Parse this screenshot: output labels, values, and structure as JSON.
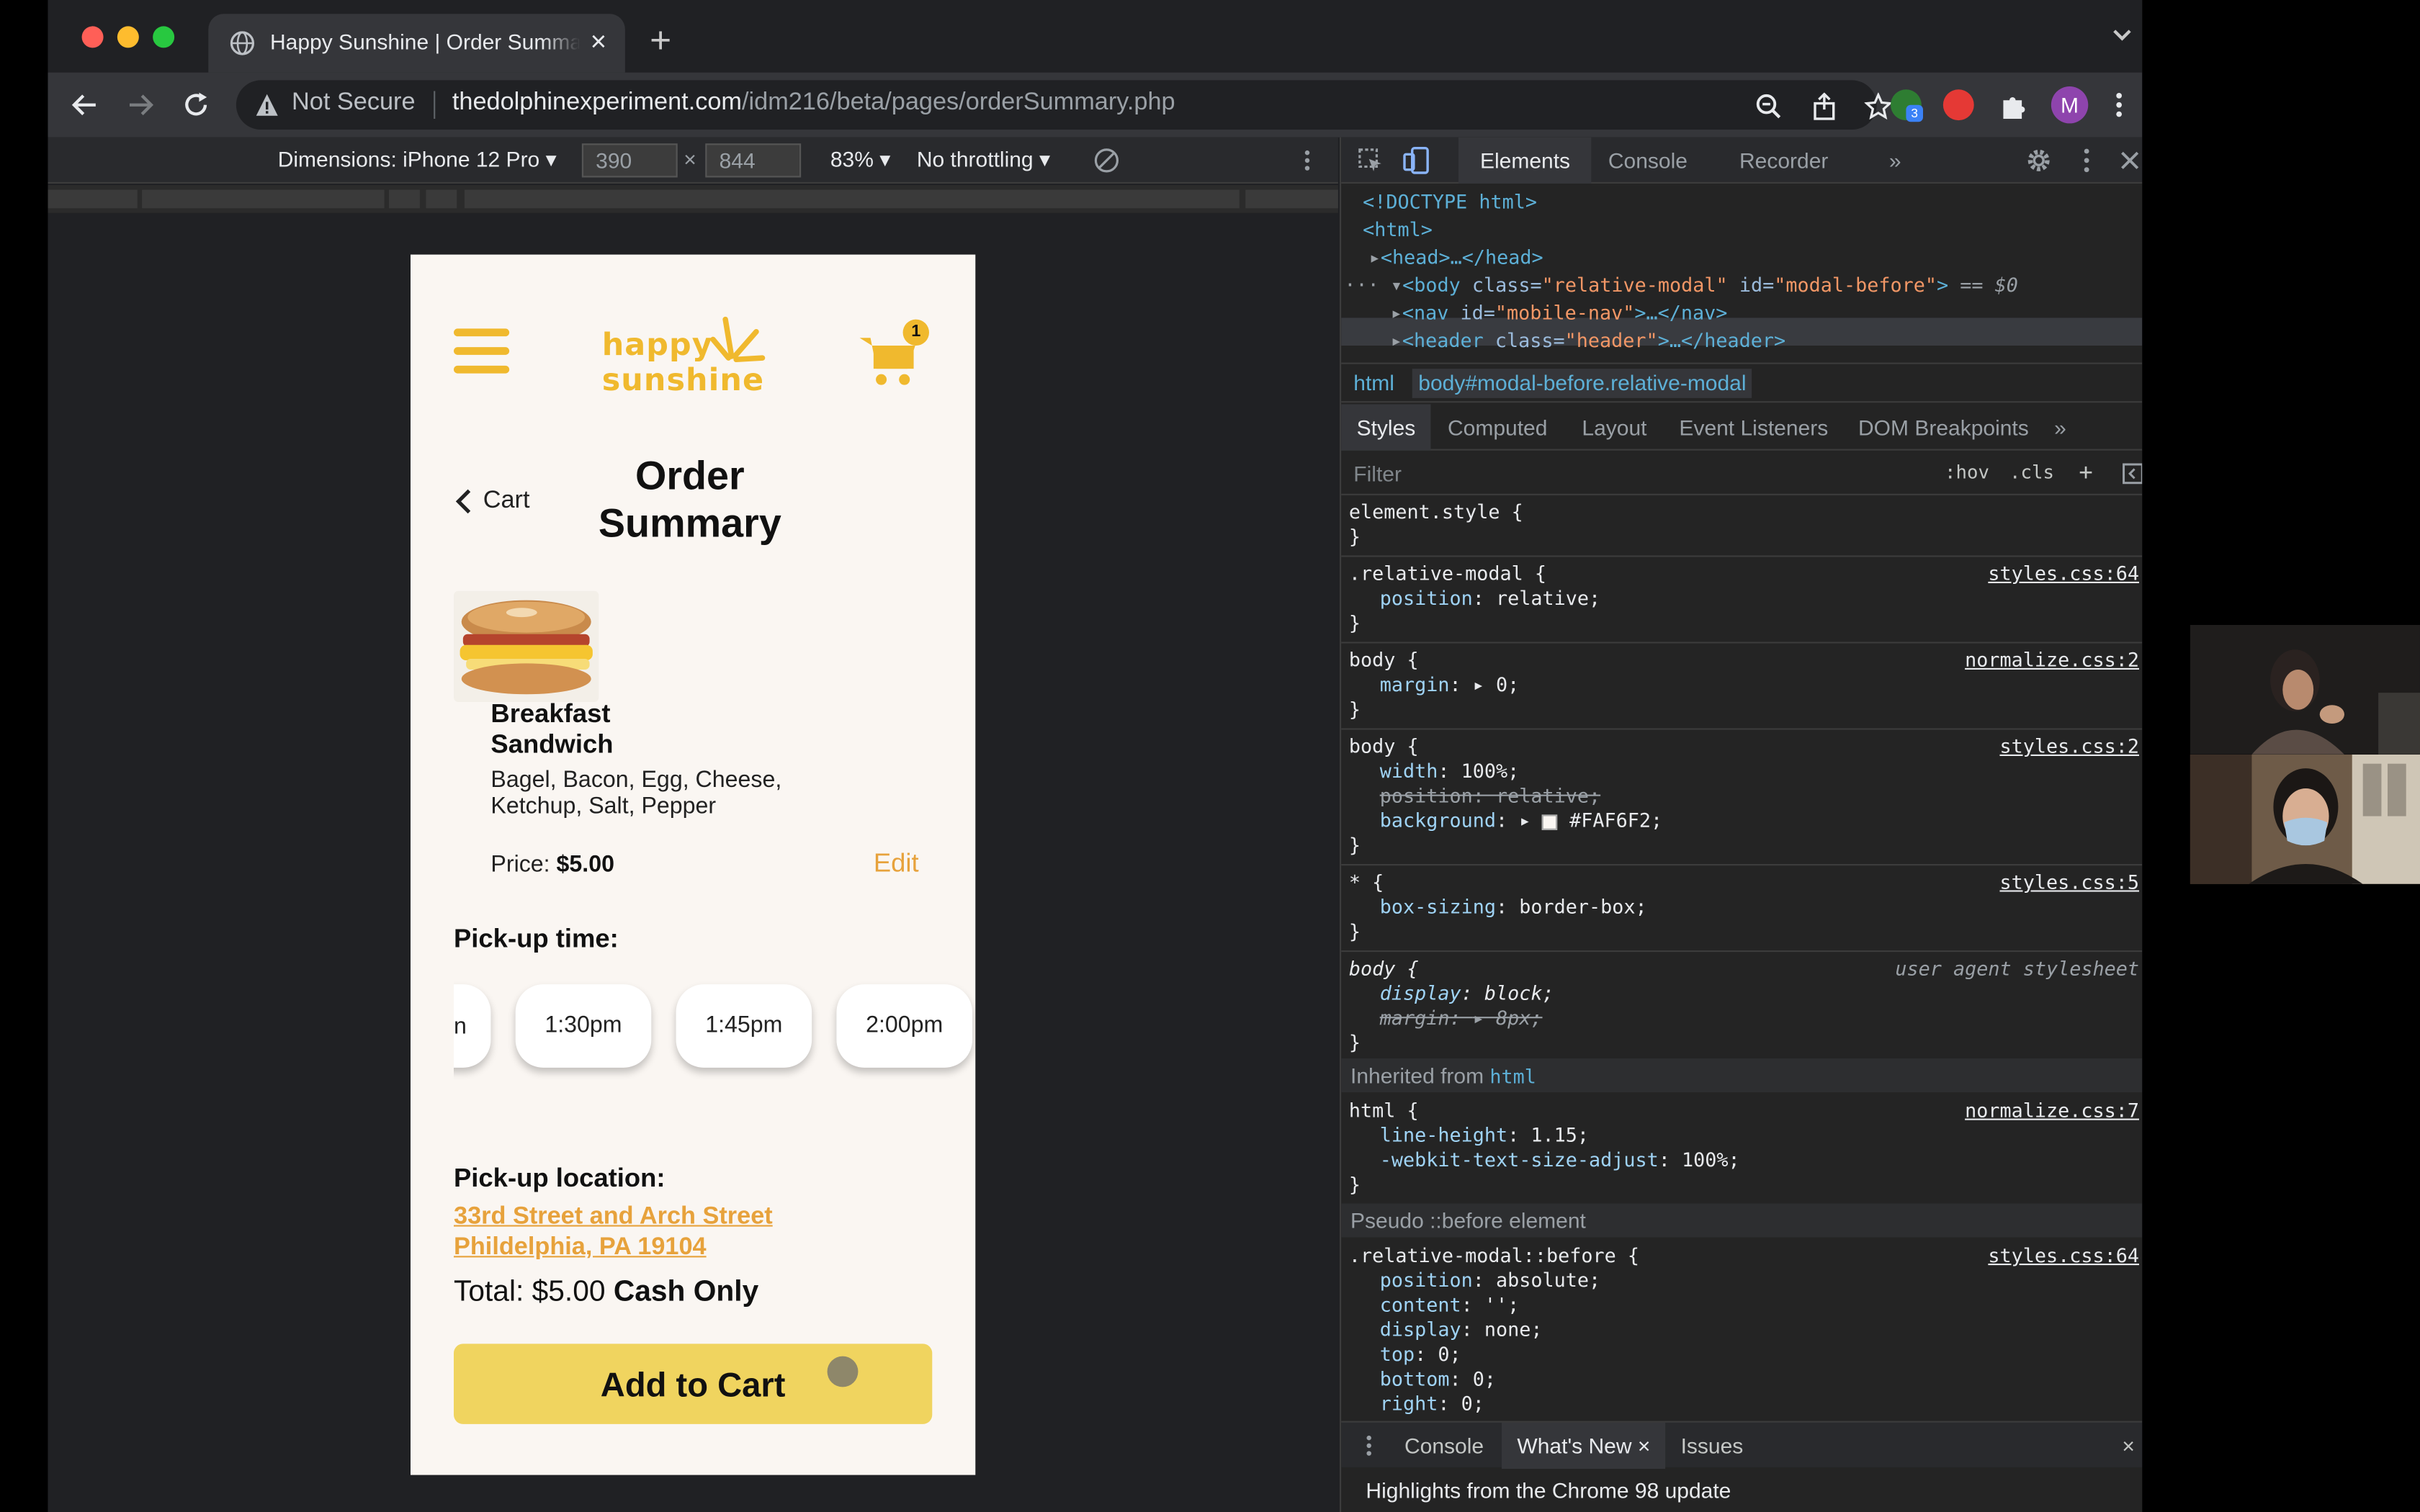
{
  "browser": {
    "tab_title": "Happy Sunshine | Order Summary",
    "tab_close": "×",
    "new_tab": "+",
    "security_label": "Not Secure",
    "url_host": "thedolphinexperiment.com",
    "url_path": "/idm216/beta/pages/orderSummary.php",
    "extension_badge": "3",
    "profile_initial": "M"
  },
  "device_toolbar": {
    "dimensions": "Dimensions: iPhone 12 Pro ▾",
    "width": "390",
    "height": "844",
    "times": "×",
    "zoom": "83% ▾",
    "throttling": "No throttling ▾"
  },
  "page": {
    "logo_line1": "happy",
    "logo_line2": "sunshine",
    "cart_count": "1",
    "back_label": "Cart",
    "title": "Order Summary",
    "item": {
      "name": "Breakfast Sandwich",
      "description": "Bagel, Bacon, Egg, Cheese, Ketchup, Salt, Pepper",
      "price_label": "Price:",
      "price": "$5.00",
      "edit_label": "Edit"
    },
    "pickup_time_heading": "Pick-up time:",
    "pickup_times": [
      "n",
      "1:30pm",
      "1:45pm",
      "2:00pm"
    ],
    "pickup_location_heading": "Pick-up location:",
    "address_line1": "33rd Street and Arch Street",
    "address_line2": "Phildelphia, PA 19104",
    "total_label": "Total: $5.00",
    "payment_note": "Cash Only",
    "add_button": "Add to Cart"
  },
  "devtools": {
    "tabs": [
      "Elements",
      "Console",
      "Recorder",
      "»"
    ],
    "dom": {
      "doctype": "<!DOCTYPE html>",
      "html_open": "<html>",
      "head": "<head>…</head>",
      "body_tag": "<body",
      "body_class_attr": " class=",
      "body_class_val": "\"relative-modal\"",
      "body_id_attr": " id=",
      "body_id_val": "\"modal-before\"",
      "body_close": ">",
      "body_eq": " == $0",
      "nav_tag": "<nav",
      "nav_id_attr": " id=",
      "nav_id_val": "\"mobile-nav\"",
      "nav_rest": ">…</nav>",
      "header_tag": "<header",
      "header_class_attr": " class=",
      "header_class_val": "\"header\"",
      "header_rest": ">…</header>"
    },
    "breadcrumbs": [
      "html",
      "body#modal-before.relative-modal"
    ],
    "sub_tabs": [
      "Styles",
      "Computed",
      "Layout",
      "Event Listeners",
      "DOM Breakpoints",
      "»"
    ],
    "filter_placeholder": "Filter",
    "filter_hov": ":hov",
    "filter_cls": ".cls",
    "filter_plus": "+",
    "rules": {
      "element_style": "element.style {",
      "close": "}",
      "r1_selector": ".relative-modal {",
      "r1_source": "styles.css:64",
      "r1_prop": "position",
      "r1_val": "relative;",
      "r2_selector": "body {",
      "r2_source": "normalize.css:2",
      "r2_prop": "margin",
      "r2_val": "▸ 0;",
      "r3_selector": "body {",
      "r3_source": "styles.css:2",
      "r3_p1": "width",
      "r3_v1": "100%;",
      "r3_p2": "position",
      "r3_v2": "relative;",
      "r3_p3": "background",
      "r3_v3": "#FAF6F2;",
      "r4_selector": "* {",
      "r4_source": "styles.css:5",
      "r4_prop": "box-sizing",
      "r4_val": "border-box;",
      "r5_selector": "body {",
      "r5_source": "user agent stylesheet",
      "r5_p1": "display",
      "r5_v1": "block;",
      "r5_p2": "margin",
      "r5_v2": "▸ 8px;",
      "inherited_label": "Inherited from ",
      "inherited_tag": "html",
      "r6_selector": "html {",
      "r6_source": "normalize.css:7",
      "r6_p1": "line-height",
      "r6_v1": "1.15;",
      "r6_p2": "-webkit-text-size-adjust",
      "r6_v2": "100%;",
      "pseudo_label": "Pseudo ::before element",
      "r7_selector": ".relative-modal::before {",
      "r7_source": "styles.css:64",
      "r7_p1": "position",
      "r7_v1": "absolute;",
      "r7_p2": "content",
      "r7_v2": "'';",
      "r7_p3": "display",
      "r7_v3": "none;",
      "r7_p4": "top",
      "r7_v4": "0;",
      "r7_p5": "bottom",
      "r7_v5": "0;",
      "r7_p6": "right",
      "r7_v6": "0;"
    },
    "drawer_tabs": [
      "Console",
      "What's New",
      "Issues"
    ],
    "drawer_close": "×",
    "whats_new_text": "Highlights from the Chrome 98 update"
  },
  "colors": {
    "brand_yellow": "#f0b92e",
    "button_yellow": "#f0d45f",
    "link_orange": "#e7a23c",
    "page_bg": "#faf6f2"
  }
}
